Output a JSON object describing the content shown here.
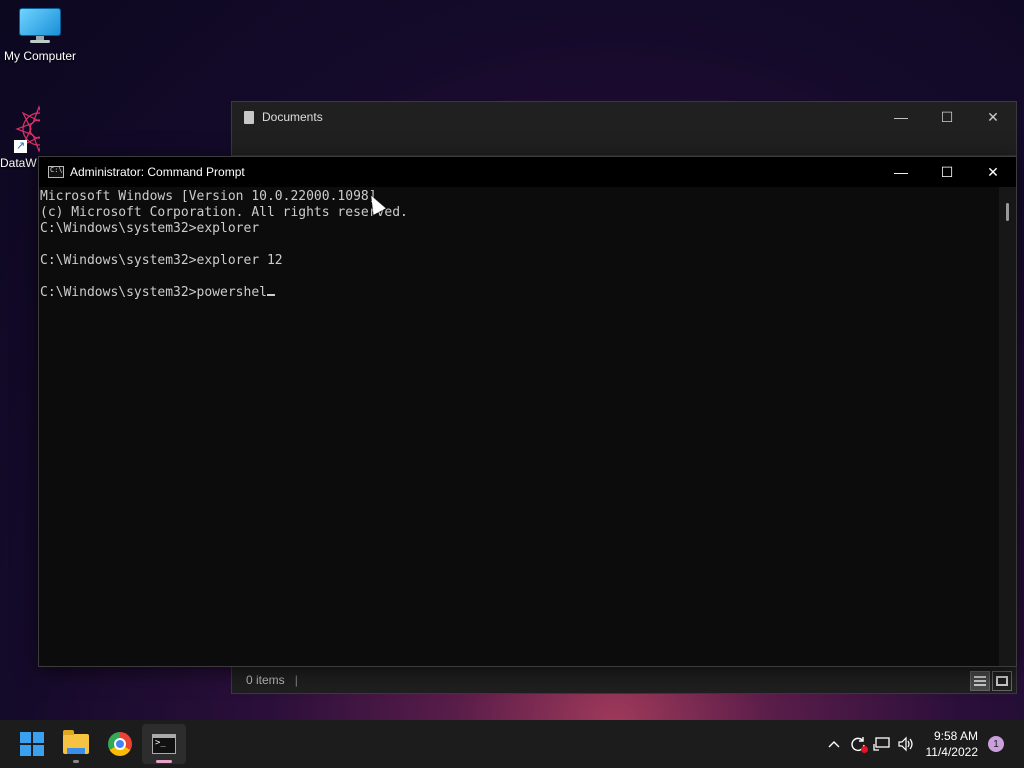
{
  "desktop": {
    "icons": [
      {
        "label": "My Computer",
        "icon": "monitor-icon"
      },
      {
        "label": "DataW",
        "icon": "dataw-shortcut-icon"
      }
    ]
  },
  "explorer": {
    "title": "Documents",
    "status_items": "0 items",
    "buttons": {
      "minimize": "—",
      "maximize": "☐",
      "close": "✕"
    }
  },
  "cmd": {
    "title": "Administrator: Command Prompt",
    "lines": [
      "Microsoft Windows [Version 10.0.22000.1098]",
      "(c) Microsoft Corporation. All rights reserved.",
      "C:\\Windows\\system32>explorer",
      "",
      "C:\\Windows\\system32>explorer 12",
      "",
      "C:\\Windows\\system32>powershel"
    ],
    "buttons": {
      "minimize": "—",
      "maximize": "☐",
      "close": "✕"
    }
  },
  "taskbar": {
    "apps": [
      "start-icon",
      "file-explorer-icon",
      "chrome-icon",
      "command-prompt-icon"
    ],
    "tray": {
      "chevron": "^",
      "time": "9:58 AM",
      "date": "11/4/2022",
      "notification_count": "1"
    }
  },
  "colors": {
    "accent": "#3aa0f0",
    "console_text": "#cccccc",
    "console_bg": "#0c0c0c"
  }
}
